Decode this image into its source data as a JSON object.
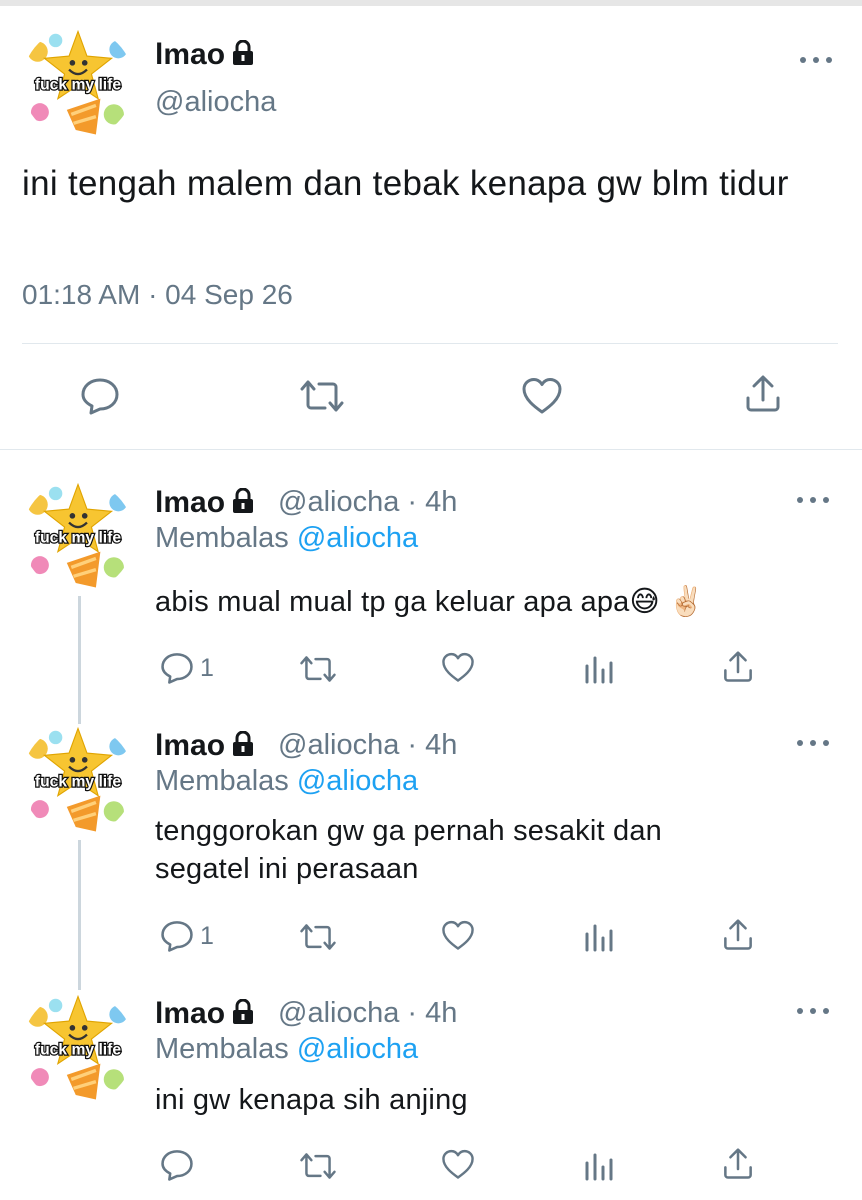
{
  "main_tweet": {
    "name": "lmao",
    "handle": "@aliocha",
    "text": "ini tengah malem dan tebak kenapa gw blm tidur",
    "timestamp": "01:18 AM · 04 Sep 26"
  },
  "avatar": {
    "label": "fuck my life",
    "icon": "emoji-party-avatar-icon"
  },
  "replies": [
    {
      "name": "lmao",
      "handle": "@aliocha",
      "time": "4h",
      "replying_label": "Membalas",
      "replying_to": "@aliocha",
      "text": "abis mual mual tp ga keluar apa apa😅 ✌🏻",
      "reply_count": "1"
    },
    {
      "name": "lmao",
      "handle": "@aliocha",
      "time": "4h",
      "replying_label": "Membalas",
      "replying_to": "@aliocha",
      "text": "tenggorokan gw ga pernah sesakit dan segatel ini perasaan",
      "reply_count": "1"
    },
    {
      "name": "lmao",
      "handle": "@aliocha",
      "time": "4h",
      "replying_label": "Membalas",
      "replying_to": "@aliocha",
      "text": "ini gw kenapa sih anjing",
      "reply_count": ""
    }
  ],
  "separator": "·",
  "colors": {
    "text": "#14171a",
    "secondary": "#657786",
    "link": "#1da1f2",
    "divider": "#e1e8ed"
  }
}
